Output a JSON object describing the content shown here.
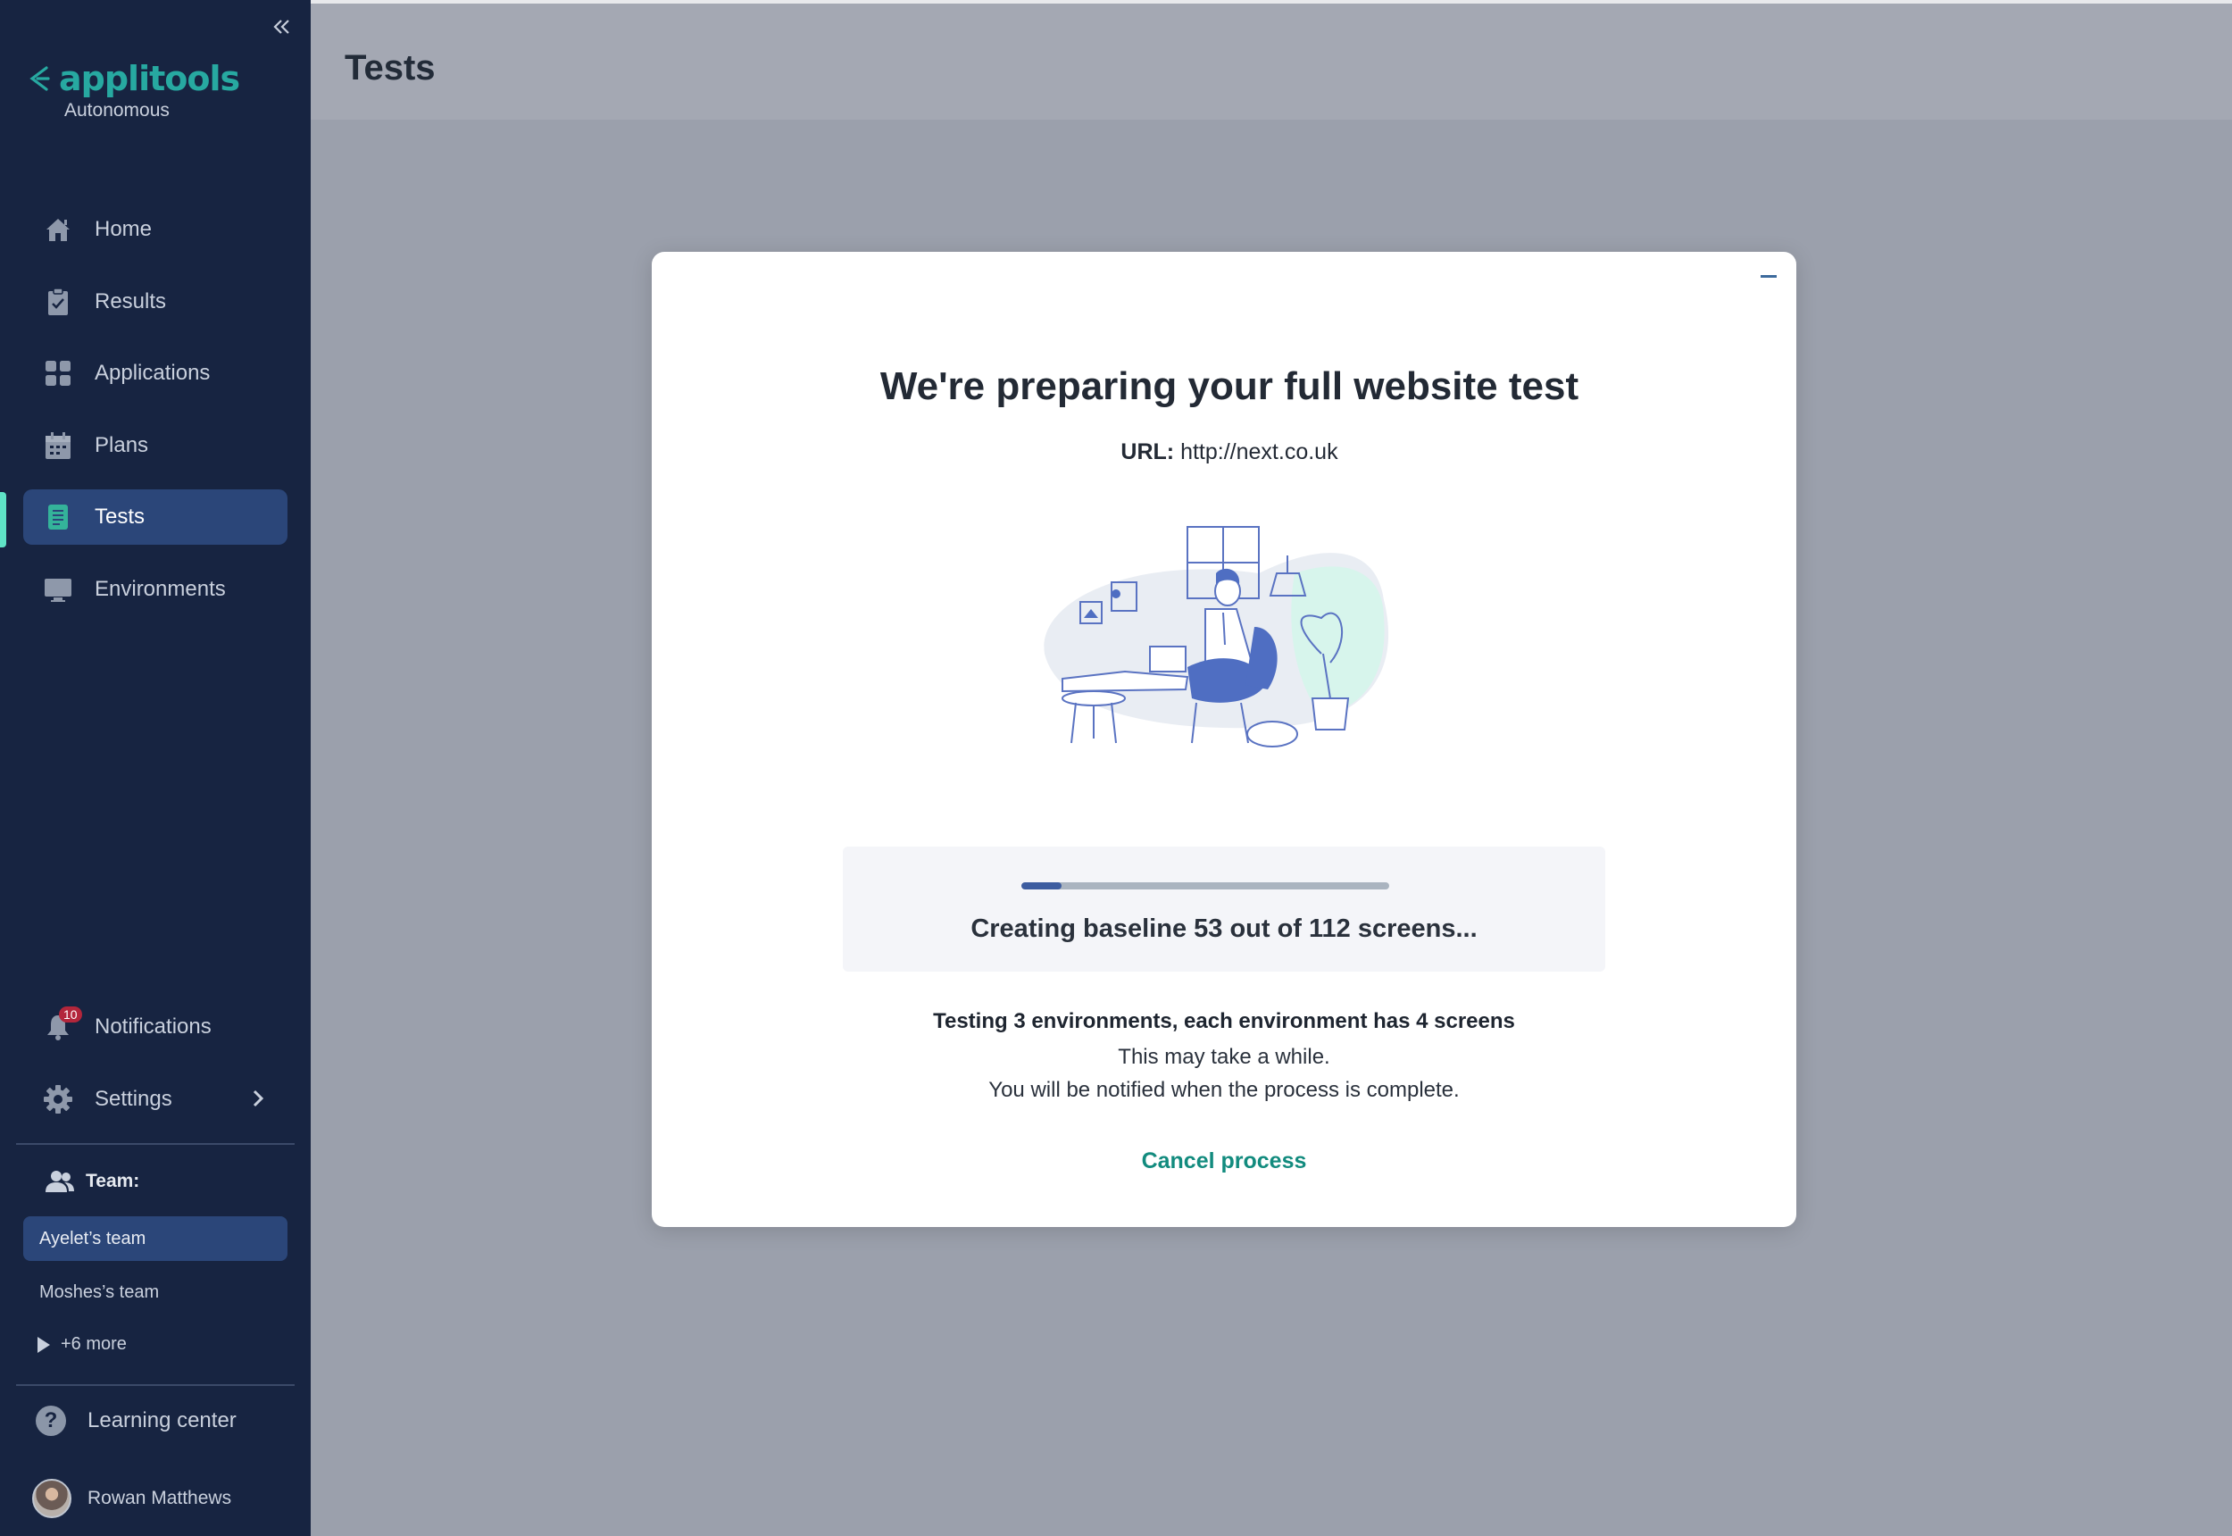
{
  "sidebar": {
    "collapse_icon": "double-chevron-left-icon",
    "logo": {
      "name": "applitools",
      "subtitle": "Autonomous",
      "brand_color": "#27a9a1"
    },
    "nav": [
      {
        "label": "Home",
        "icon": "home-icon"
      },
      {
        "label": "Results",
        "icon": "clipboard-check-icon"
      },
      {
        "label": "Applications",
        "icon": "grid-icon"
      },
      {
        "label": "Plans",
        "icon": "calendar-icon"
      },
      {
        "label": "Tests",
        "icon": "test-list-icon",
        "active": true
      },
      {
        "label": "Environments",
        "icon": "monitor-icon"
      }
    ],
    "notifications": {
      "label": "Notifications",
      "count": "10",
      "icon": "bell-icon"
    },
    "settings": {
      "label": "Settings",
      "icon": "gear-icon"
    },
    "team": {
      "label": "Team:",
      "items": [
        "Ayelet’s team",
        "Moshes’s team"
      ],
      "more": "+6 more"
    },
    "learning_center": "Learning center",
    "user": {
      "name": "Rowan Matthews"
    },
    "active_color": "#5fe3c6",
    "background": "#172441"
  },
  "header": {
    "title": "Tests"
  },
  "modal": {
    "title": "We're preparing your full website test",
    "url_label": "URL:",
    "url_value": "http://next.co.uk",
    "progress": {
      "fraction": 0.11,
      "text": "Creating baseline 53 out of 112 screens..."
    },
    "info_bold": "Testing 3 environments, each environment has 4 screens",
    "info_line1": "This may take a while.",
    "info_line2": "You will be notified when the process is complete.",
    "cancel_label": "Cancel process",
    "accent_color": "#128b7e"
  }
}
